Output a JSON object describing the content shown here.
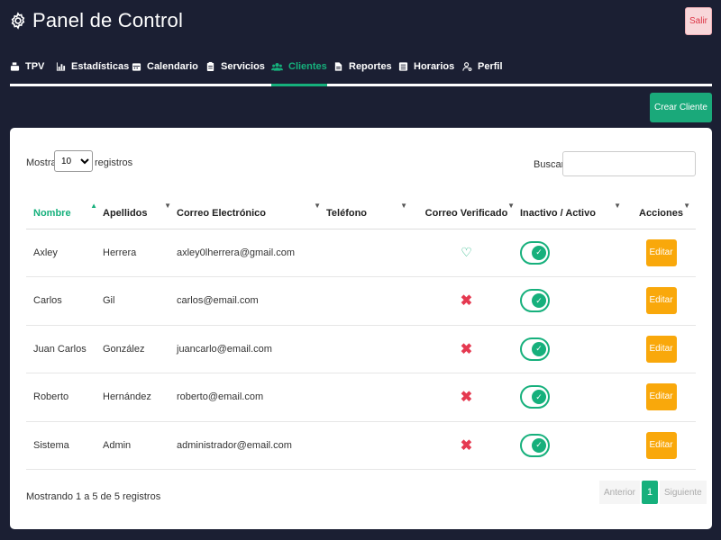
{
  "header": {
    "title": "Panel de Control",
    "logout_label": "Salir"
  },
  "nav": {
    "items": [
      {
        "label": "TPV",
        "icon": "cash-register-icon"
      },
      {
        "label": "Estadísticas",
        "icon": "chart-icon"
      },
      {
        "label": "Calendario",
        "icon": "calendar-icon"
      },
      {
        "label": "Servicios",
        "icon": "clipboard-icon"
      },
      {
        "label": "Clientes",
        "icon": "users-icon",
        "active": true
      },
      {
        "label": "Reportes",
        "icon": "file-icon"
      },
      {
        "label": "Horarios",
        "icon": "schedule-icon"
      },
      {
        "label": "Perfil",
        "icon": "user-gear-icon"
      }
    ]
  },
  "toolbar": {
    "create_label": "Crear Cliente"
  },
  "table_controls": {
    "show_label": "Mostrar",
    "page_length": "10",
    "records_label": "registros",
    "search_label": "Buscar:"
  },
  "table": {
    "headers": {
      "name": "Nombre",
      "last_name": "Apellidos",
      "email": "Correo Electrónico",
      "phone": "Teléfono",
      "verified": "Correo Verificado",
      "active": "Inactivo / Activo",
      "actions": "Acciones"
    },
    "edit_label": "Editar",
    "rows": [
      {
        "name": "Axley",
        "last_name": "Herrera",
        "email": "axley0lherrera@gmail.com",
        "phone": "",
        "verified": true,
        "active": true
      },
      {
        "name": "Carlos",
        "last_name": "Gil",
        "email": "carlos@email.com",
        "phone": "",
        "verified": false,
        "active": true
      },
      {
        "name": "Juan Carlos",
        "last_name": "González",
        "email": "juancarlo@email.com",
        "phone": "",
        "verified": false,
        "active": true
      },
      {
        "name": "Roberto",
        "last_name": "Hernández",
        "email": "roberto@email.com",
        "phone": "",
        "verified": false,
        "active": true
      },
      {
        "name": "Sistema",
        "last_name": "Admin",
        "email": "administrador@email.com",
        "phone": "",
        "verified": false,
        "active": true
      }
    ]
  },
  "footer": {
    "info": "Mostrando 1 a 5 de 5 registros",
    "prev_label": "Anterior",
    "page": "1",
    "next_label": "Siguiente"
  },
  "colors": {
    "background": "#1b1f33",
    "accent": "#16b07c",
    "warning": "#f9a80b",
    "danger": "#e53950"
  }
}
